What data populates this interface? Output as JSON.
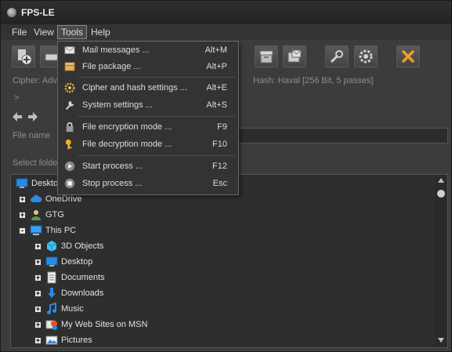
{
  "app": {
    "title": "FPS-LE"
  },
  "menubar": {
    "items": [
      "File",
      "View",
      "Tools",
      "Help"
    ]
  },
  "tools_menu": {
    "items": [
      {
        "label": "Mail messages ...",
        "shortcut": "Alt+M",
        "icon": "envelope-icon"
      },
      {
        "label": "File package ...",
        "shortcut": "Alt+P",
        "icon": "package-icon"
      },
      {
        "label": "Cipher and hash settings ...",
        "shortcut": "Alt+E",
        "icon": "gear-icon"
      },
      {
        "label": "System settings ...",
        "shortcut": "Alt+S",
        "icon": "wrench-icon"
      },
      {
        "label": "File encryption mode ...",
        "shortcut": "F9",
        "icon": "lock-icon"
      },
      {
        "label": "File decryption mode ...",
        "shortcut": "F10",
        "icon": "key-icon"
      },
      {
        "label": "Start process ...",
        "shortcut": "F12",
        "icon": "play-icon"
      },
      {
        "label": "Stop process ...",
        "shortcut": "Esc",
        "icon": "stop-icon"
      }
    ]
  },
  "info": {
    "cipher_label": "Cipher:  Adv",
    "hash_label": "Hash:  Haval [256 Bit, 5 passes]",
    "path_prompt": ">",
    "file_name_label": "File name",
    "select_folder_label": "Select folde"
  },
  "tree": {
    "items": [
      {
        "label": "Desktop",
        "level": 0,
        "icon": "desktop-icon",
        "expander": ""
      },
      {
        "label": "OneDrive",
        "level": 1,
        "icon": "cloud-icon",
        "expander": "+"
      },
      {
        "label": "GTG",
        "level": 1,
        "icon": "user-icon",
        "expander": "+"
      },
      {
        "label": "This PC",
        "level": 1,
        "icon": "computer-icon",
        "expander": "-"
      },
      {
        "label": "3D Objects",
        "level": 2,
        "icon": "cube-icon",
        "expander": "+"
      },
      {
        "label": "Desktop",
        "level": 2,
        "icon": "desktop-icon",
        "expander": "+"
      },
      {
        "label": "Documents",
        "level": 2,
        "icon": "document-icon",
        "expander": "+"
      },
      {
        "label": "Downloads",
        "level": 2,
        "icon": "download-icon",
        "expander": "+"
      },
      {
        "label": "Music",
        "level": 2,
        "icon": "music-icon",
        "expander": "+"
      },
      {
        "label": "My Web Sites on MSN",
        "level": 2,
        "icon": "websites-icon",
        "expander": "+"
      },
      {
        "label": "Pictures",
        "level": 2,
        "icon": "pictures-icon",
        "expander": "+"
      }
    ]
  },
  "colors": {
    "background": "#3c3c3c",
    "accent": "#f0a020",
    "menu_bg": "#333333"
  }
}
